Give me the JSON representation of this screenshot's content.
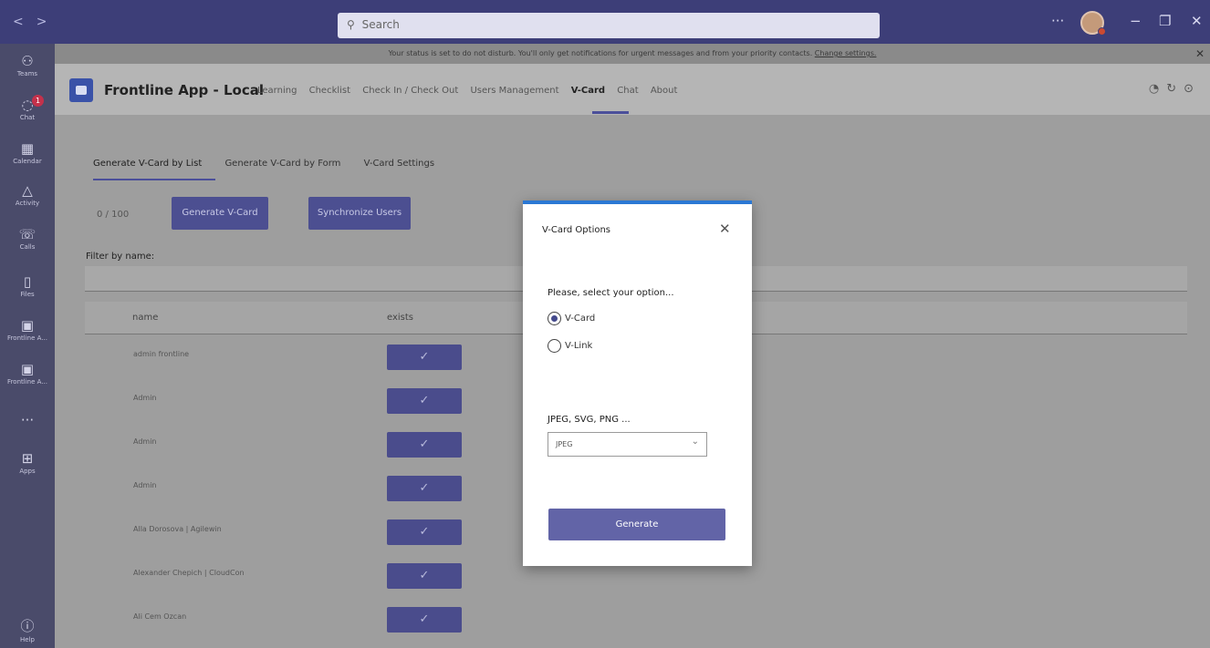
{
  "titlebar": {
    "search_placeholder": "Search",
    "more": "···",
    "minimize": "−",
    "maximize": "❐",
    "close": "✕"
  },
  "rail": {
    "items": [
      {
        "label": "Teams",
        "icon": "teams-icon"
      },
      {
        "label": "Chat",
        "icon": "chat-icon",
        "badge": "1"
      },
      {
        "label": "Calendar",
        "icon": "calendar-icon"
      },
      {
        "label": "Activity",
        "icon": "bell-icon"
      },
      {
        "label": "Calls",
        "icon": "phone-icon"
      },
      {
        "label": "Files",
        "icon": "file-icon"
      },
      {
        "label": "Frontline A...",
        "icon": "app-icon"
      },
      {
        "label": "Frontline A...",
        "icon": "app-icon"
      },
      {
        "label": "",
        "icon": "more-icon"
      },
      {
        "label": "Apps",
        "icon": "apps-grid-icon"
      },
      {
        "label": "Help",
        "icon": "help-icon"
      }
    ]
  },
  "notification": {
    "text": "Your status is set to do not disturb. You'll only get notifications for urgent messages and from your priority contacts.",
    "link": "Change settings.",
    "close": "✕"
  },
  "app": {
    "title": "Frontline App - Local",
    "tabs": [
      "Learning",
      "Checklist",
      "Check In / Check Out",
      "Users Management",
      "V-Card",
      "Chat",
      "About"
    ],
    "active_tab": "V-Card"
  },
  "content": {
    "subtabs": [
      "Generate V-Card by List",
      "Generate V-Card by Form",
      "V-Card Settings"
    ],
    "counter": "0 / 100",
    "generate_button": "Generate V-Card",
    "sync_button": "Synchronize Users",
    "filter_label": "Filter by name:",
    "columns": [
      "name",
      "exists"
    ],
    "rows": [
      {
        "name": "admin frontline",
        "exists": "✓"
      },
      {
        "name": "Admin",
        "exists": "✓"
      },
      {
        "name": "Admin",
        "exists": "✓"
      },
      {
        "name": "Admin",
        "exists": "✓"
      },
      {
        "name": "Alla Dorosova | Agilewin",
        "exists": "✓"
      },
      {
        "name": "Alexander Chepich | CloudCon",
        "exists": "✓"
      },
      {
        "name": "Ali Cem Ozcan",
        "exists": "✓"
      }
    ]
  },
  "dialog": {
    "title": "V-Card Options",
    "close": "✕",
    "prompt": "Please, select your option...",
    "options": [
      {
        "label": "V-Card",
        "checked": true
      },
      {
        "label": "V-Link",
        "checked": false
      }
    ],
    "format_label": "JPEG, SVG, PNG ...",
    "format_value": "JPEG",
    "generate": "Generate"
  },
  "colors": {
    "accent": "#6264a7",
    "titlebar": "#3d3e78",
    "dialog_top": "#2b78d4"
  }
}
